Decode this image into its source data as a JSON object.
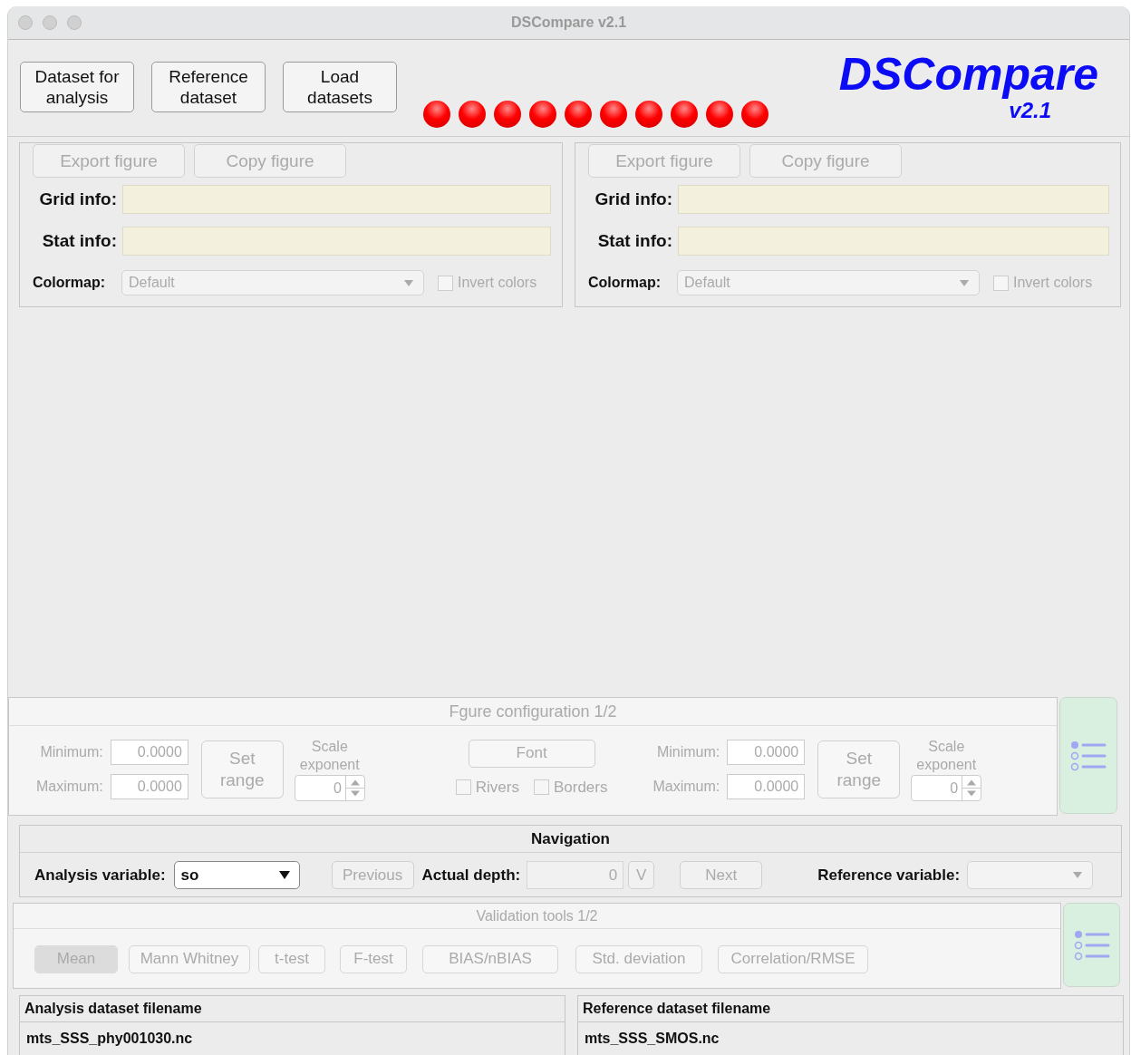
{
  "window": {
    "title": "DSCompare v2.1"
  },
  "toolbar": {
    "buttons": [
      {
        "label": "Dataset for analysis",
        "disabled": false
      },
      {
        "label": "Reference dataset",
        "disabled": false
      },
      {
        "label": "Load datasets",
        "disabled": false
      }
    ],
    "status_lamps": [
      {
        "loaded": false
      },
      {
        "loaded": false
      },
      {
        "loaded": false
      },
      {
        "loaded": false
      },
      {
        "loaded": false
      },
      {
        "loaded": false
      },
      {
        "loaded": false
      },
      {
        "loaded": false
      },
      {
        "loaded": false
      },
      {
        "loaded": false
      }
    ],
    "logo": {
      "name": "DSCompare",
      "version": "v2.1"
    }
  },
  "figure_panels": [
    {
      "buttons": [
        {
          "label": "Export figure",
          "disabled": true
        },
        {
          "label": "Copy figure",
          "disabled": true
        }
      ],
      "grid_info_label": "Grid info:",
      "stat_info_label": "Stat info:",
      "colormap_label": "Colormap:",
      "colormap_value": "Default",
      "invert_colors": {
        "label": "Invert colors",
        "checked": false
      }
    },
    {
      "buttons": [
        {
          "label": "Export figure",
          "disabled": true
        },
        {
          "label": "Copy figure",
          "disabled": true
        }
      ],
      "grid_info_label": "Grid info:",
      "stat_info_label": "Stat info:",
      "colormap_label": "Colormap:",
      "colormap_value": "Default",
      "invert_colors": {
        "label": "Invert colors",
        "checked": false
      }
    }
  ],
  "figure_configuration": {
    "title": "Fgure configuration 1/2",
    "ranges": [
      {
        "minimum_label": "Minimum:",
        "minimum_value": "0.0000",
        "maximum_label": "Maximum:",
        "maximum_value": "0.0000",
        "set_range": "Set range",
        "scale_exponent_label": "Scale exponent",
        "scale_exponent_value": "0"
      },
      {
        "minimum_label": "Minimum:",
        "minimum_value": "0.0000",
        "maximum_label": "Maximum:",
        "maximum_value": "0.0000",
        "set_range": "Set range",
        "scale_exponent_label": "Scale exponent",
        "scale_exponent_value": "0"
      }
    ],
    "font_button": "Font",
    "checkboxes": [
      {
        "label": "Rivers",
        "checked": false
      },
      {
        "label": "Borders",
        "checked": false
      }
    ]
  },
  "navigation": {
    "title": "Navigation",
    "analysis_variable_label": "Analysis variable:",
    "analysis_variable_value": "so",
    "previous": "Previous",
    "actual_depth_label": "Actual depth:",
    "actual_depth_value": "0",
    "depth_button": "V",
    "next": "Next",
    "reference_variable_label": "Reference variable:"
  },
  "validation_tools": {
    "title": "Validation tools 1/2",
    "buttons": [
      {
        "label": "Mean",
        "selected": true
      },
      {
        "label": "Mann Whitney",
        "selected": false
      },
      {
        "label": "t-test",
        "selected": false
      },
      {
        "label": "F-test",
        "selected": false
      },
      {
        "label": "BIAS/nBIAS",
        "selected": false
      },
      {
        "label": "Std. deviation",
        "selected": false
      },
      {
        "label": "Correlation/RMSE",
        "selected": false
      }
    ]
  },
  "filenames": [
    {
      "header": "Analysis dataset filename",
      "value": "mts_SSS_phy001030.nc"
    },
    {
      "header": "Reference dataset filename",
      "value": "mts_SSS_SMOS.nc"
    }
  ]
}
